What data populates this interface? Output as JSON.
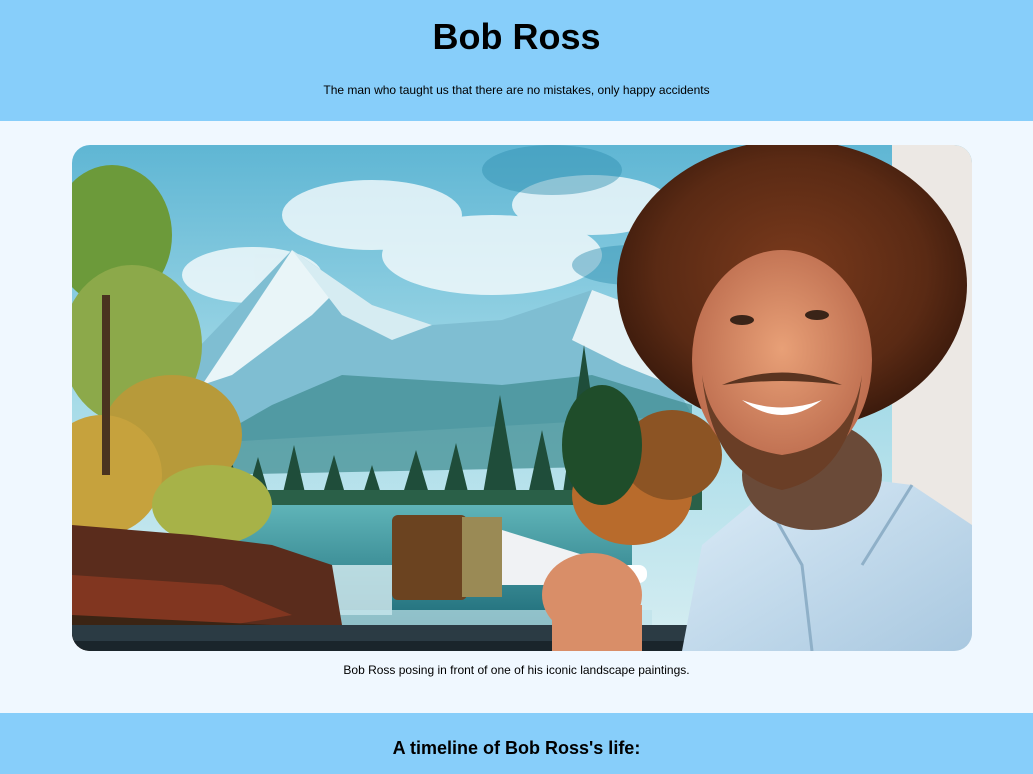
{
  "header": {
    "title": "Bob Ross",
    "tagline": "The man who taught us that there are no mistakes, only happy accidents"
  },
  "figure": {
    "image_alt": "Bob Ross posing in front of one of his iconic landscape paintings",
    "caption": "Bob Ross posing in front of one of his iconic landscape paintings."
  },
  "timeline": {
    "heading": "A timeline of Bob Ross's life:"
  },
  "colors": {
    "header_bg": "#87cefa",
    "page_bg": "#f0f8ff"
  }
}
